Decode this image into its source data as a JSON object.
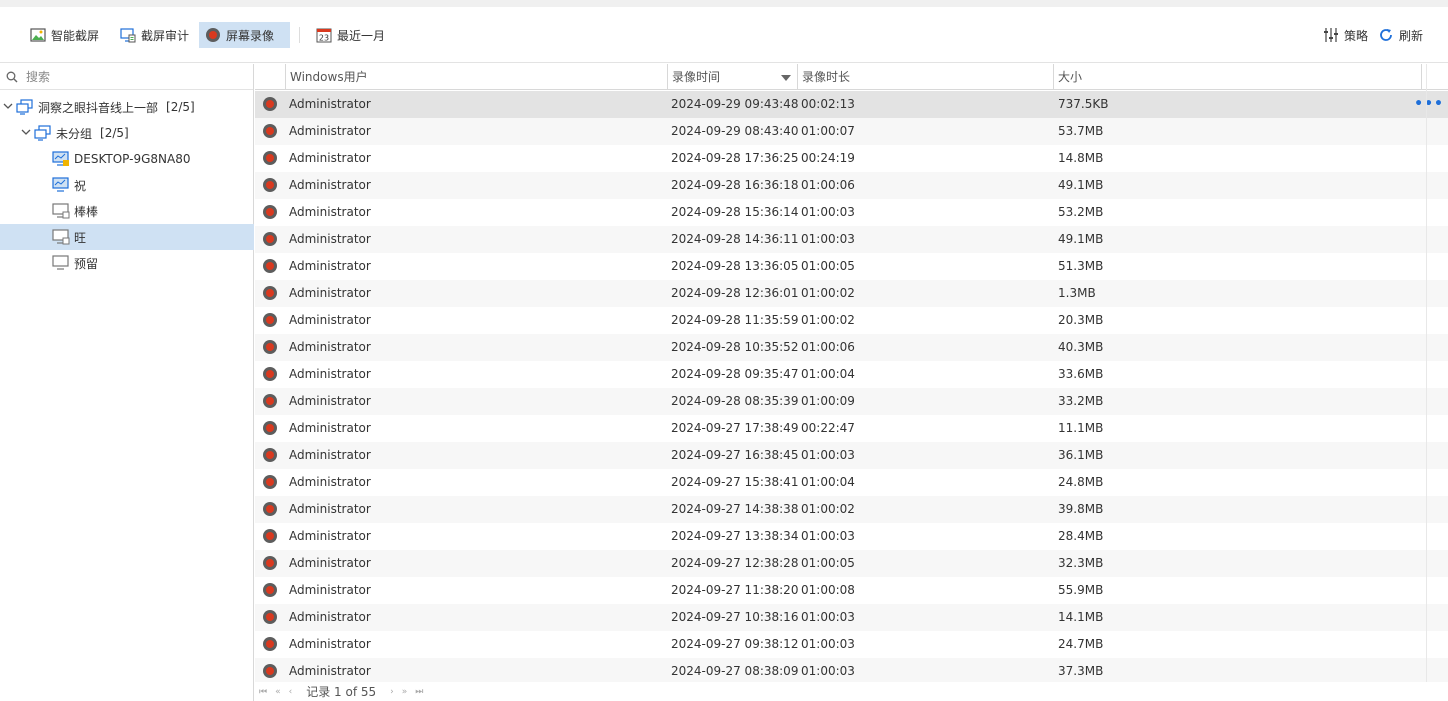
{
  "toolbar": {
    "smart_capture": "智能截屏",
    "capture_audit": "截屏审计",
    "screen_record": "屏幕录像",
    "last_month": "最近一月",
    "policy": "策略",
    "refresh": "刷新",
    "calendar_day": "23"
  },
  "sidebar": {
    "search_placeholder": "搜索",
    "tree": [
      {
        "label": "洞察之眼抖音线上一部",
        "count": "[2/5]"
      },
      {
        "label": "未分组",
        "count": "[2/5]"
      },
      {
        "label": "DESKTOP-9G8NA80"
      },
      {
        "label": "祝"
      },
      {
        "label": "棒棒"
      },
      {
        "label": "旺"
      },
      {
        "label": "预留"
      }
    ]
  },
  "grid": {
    "columns": [
      "Windows用户",
      "录像时间",
      "录像时长",
      "大小"
    ],
    "rows": [
      {
        "user": "Administrator",
        "time": "2024-09-29 09:43:48",
        "duration": "00:02:13",
        "size": "737.5KB"
      },
      {
        "user": "Administrator",
        "time": "2024-09-29 08:43:40",
        "duration": "01:00:07",
        "size": "53.7MB"
      },
      {
        "user": "Administrator",
        "time": "2024-09-28 17:36:25",
        "duration": "00:24:19",
        "size": "14.8MB"
      },
      {
        "user": "Administrator",
        "time": "2024-09-28 16:36:18",
        "duration": "01:00:06",
        "size": "49.1MB"
      },
      {
        "user": "Administrator",
        "time": "2024-09-28 15:36:14",
        "duration": "01:00:03",
        "size": "53.2MB"
      },
      {
        "user": "Administrator",
        "time": "2024-09-28 14:36:11",
        "duration": "01:00:03",
        "size": "49.1MB"
      },
      {
        "user": "Administrator",
        "time": "2024-09-28 13:36:05",
        "duration": "01:00:05",
        "size": "51.3MB"
      },
      {
        "user": "Administrator",
        "time": "2024-09-28 12:36:01",
        "duration": "01:00:02",
        "size": "1.3MB"
      },
      {
        "user": "Administrator",
        "time": "2024-09-28 11:35:59",
        "duration": "01:00:02",
        "size": "20.3MB"
      },
      {
        "user": "Administrator",
        "time": "2024-09-28 10:35:52",
        "duration": "01:00:06",
        "size": "40.3MB"
      },
      {
        "user": "Administrator",
        "time": "2024-09-28 09:35:47",
        "duration": "01:00:04",
        "size": "33.6MB"
      },
      {
        "user": "Administrator",
        "time": "2024-09-28 08:35:39",
        "duration": "01:00:09",
        "size": "33.2MB"
      },
      {
        "user": "Administrator",
        "time": "2024-09-27 17:38:49",
        "duration": "00:22:47",
        "size": "11.1MB"
      },
      {
        "user": "Administrator",
        "time": "2024-09-27 16:38:45",
        "duration": "01:00:03",
        "size": "36.1MB"
      },
      {
        "user": "Administrator",
        "time": "2024-09-27 15:38:41",
        "duration": "01:00:04",
        "size": "24.8MB"
      },
      {
        "user": "Administrator",
        "time": "2024-09-27 14:38:38",
        "duration": "01:00:02",
        "size": "39.8MB"
      },
      {
        "user": "Administrator",
        "time": "2024-09-27 13:38:34",
        "duration": "01:00:03",
        "size": "28.4MB"
      },
      {
        "user": "Administrator",
        "time": "2024-09-27 12:38:28",
        "duration": "01:00:05",
        "size": "32.3MB"
      },
      {
        "user": "Administrator",
        "time": "2024-09-27 11:38:20",
        "duration": "01:00:08",
        "size": "55.9MB"
      },
      {
        "user": "Administrator",
        "time": "2024-09-27 10:38:16",
        "duration": "01:00:03",
        "size": "14.1MB"
      },
      {
        "user": "Administrator",
        "time": "2024-09-27 09:38:12",
        "duration": "01:00:03",
        "size": "24.7MB"
      },
      {
        "user": "Administrator",
        "time": "2024-09-27 08:38:09",
        "duration": "01:00:03",
        "size": "37.3MB"
      }
    ],
    "more_icon": "•••"
  },
  "pager": {
    "text": "记录 1 of 55",
    "first": "⏮",
    "prev_page": "«",
    "prev": "‹",
    "next": "›",
    "next_page": "»",
    "last": "⏭"
  },
  "colors": {
    "accent": "#cfe1f3",
    "record_red": "#d9391f",
    "link_blue": "#1e6fd9"
  }
}
